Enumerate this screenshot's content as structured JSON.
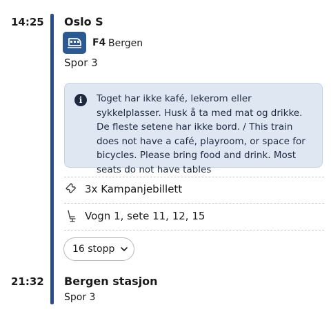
{
  "departure": {
    "time": "14:25",
    "station": "Oslo S",
    "track": "Spor 3"
  },
  "service": {
    "icon": "train-icon",
    "line_code": "F4",
    "destination": "Bergen",
    "icon_bg_color": "#2a5a91"
  },
  "notice": {
    "icon": "info-icon",
    "text": "Toget har ikke kafé, lekerom eller sykkelplasser. Husk å ta med mat og drikke. De fleste setene har ikke bord. / This train does not have a café, playroom, or space for bicycles. Please bring food and drink. Most seats do not have tables",
    "bg_color": "#dfe7f2"
  },
  "ticket": {
    "icon": "ticket-icon",
    "label": "3x Kampanjebillett"
  },
  "seat": {
    "icon": "seat-icon",
    "label": "Vogn 1, sete 11, 12, 15"
  },
  "stops_button": {
    "label": "16 stopp",
    "icon": "chevron-down-icon"
  },
  "arrival": {
    "time": "21:32",
    "station": "Bergen stasjon",
    "track": "Spor 3"
  },
  "colors": {
    "rail": "#2a4e8c",
    "text": "#1b1b1b"
  }
}
